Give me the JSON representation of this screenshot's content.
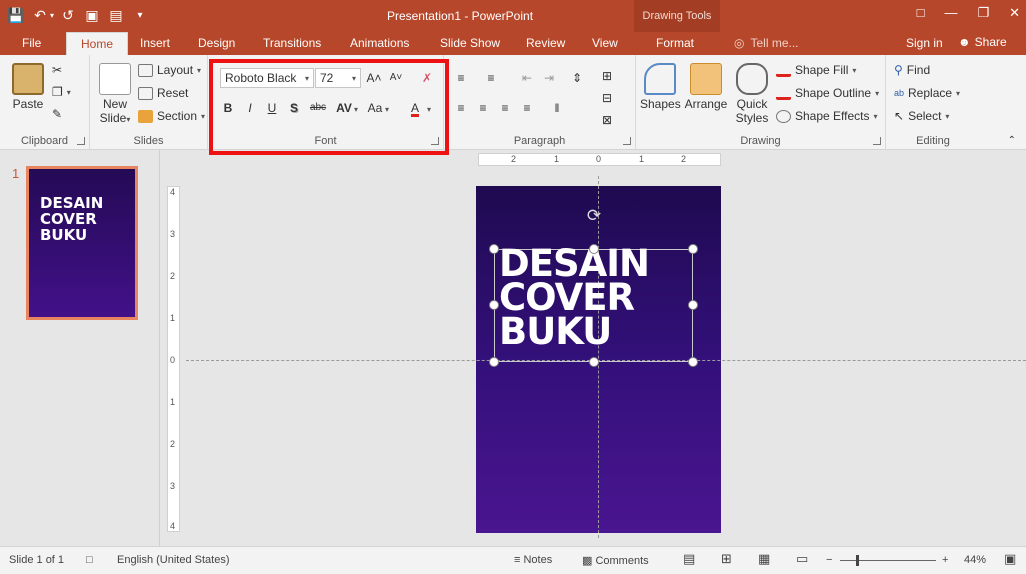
{
  "window": {
    "title": "Presentation1 - PowerPoint",
    "context_group": "Drawing Tools"
  },
  "tabs": [
    "File",
    "Home",
    "Insert",
    "Design",
    "Transitions",
    "Animations",
    "Slide Show",
    "Review",
    "View",
    "Format"
  ],
  "active_tab": "Home",
  "tell_me": "Tell me...",
  "sign_in": "Sign in",
  "share": "Share",
  "ribbon": {
    "clipboard": {
      "label": "Clipboard",
      "paste": "Paste"
    },
    "slides": {
      "label": "Slides",
      "new_slide": "New",
      "new_slide2": "Slide",
      "layout": "Layout",
      "reset": "Reset",
      "section": "Section"
    },
    "font": {
      "label": "Font",
      "font_name": "Roboto Black",
      "font_size": "72",
      "bold": "B",
      "italic": "I",
      "underline": "U",
      "shadow": "S",
      "strike": "abc",
      "spacing": "AV",
      "case": "Aa",
      "color": "A"
    },
    "paragraph": {
      "label": "Paragraph"
    },
    "drawing": {
      "label": "Drawing",
      "shapes": "Shapes",
      "arrange": "Arrange",
      "quick": "Quick",
      "styles": "Styles",
      "fill": "Shape Fill",
      "outline": "Shape Outline",
      "effects": "Shape Effects"
    },
    "editing": {
      "label": "Editing",
      "find": "Find",
      "replace": "Replace",
      "select": "Select"
    }
  },
  "thumbnail": {
    "number": "1",
    "text_lines": [
      "DESAIN",
      "COVER",
      "BUKU"
    ]
  },
  "slide": {
    "text_lines": [
      "DESAIN",
      "COVER",
      "BUKU"
    ]
  },
  "ruler": {
    "h_labels": [
      "2",
      "1",
      "0",
      "1",
      "2"
    ],
    "v_labels": [
      "4",
      "3",
      "2",
      "1",
      "0",
      "1",
      "2",
      "3",
      "4"
    ]
  },
  "status": {
    "slide_info": "Slide 1 of 1",
    "language": "English (United States)",
    "notes": "Notes",
    "comments": "Comments",
    "zoom": "44%",
    "zoom_minus": "−",
    "zoom_plus": "+"
  },
  "colors": {
    "accent": "#b7472a",
    "slide_top": "#1f0a50",
    "slide_bottom": "#4a1590",
    "highlight": "#ee1111"
  }
}
